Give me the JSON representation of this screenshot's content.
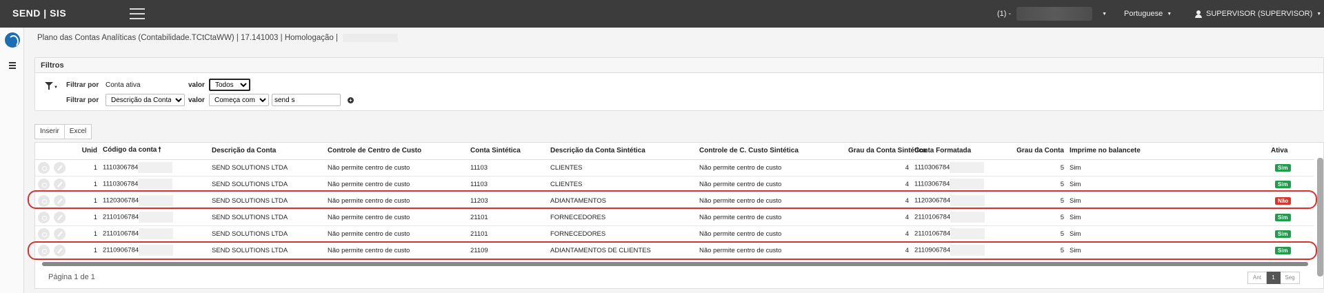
{
  "topbar": {
    "brand": "SEND | SIS",
    "company_prefix": "(1) -",
    "language": "Portuguese",
    "user": "SUPERVISOR (SUPERVISOR)"
  },
  "breadcrumb": "Plano das Contas Analíticas (Contabilidade.TCtCtaWW) | 17.141003 | Homologação |",
  "filters": {
    "title": "Filtros",
    "row1": {
      "label": "Filtrar por",
      "field": "Conta ativa",
      "value_label": "valor",
      "value_selected": "Todos"
    },
    "row2": {
      "label": "Filtrar por",
      "field_selected": "Descrição da Conta",
      "value_label": "valor",
      "operator_selected": "Começa com",
      "text_value": "send s"
    }
  },
  "toolbar": {
    "insert": "Inserir",
    "excel": "Excel"
  },
  "columns": [
    "Unid",
    "Código da conta",
    "Descrição da Conta",
    "Controle de Centro de Custo",
    "Conta Sintética",
    "Descrição da Conta Sintética",
    "Controle de C. Custo Sintética",
    "Grau da Conta Sintética",
    "Conta Formatada",
    "Grau da Conta",
    "Imprime no balancete",
    "Ativa"
  ],
  "sort_indicator": "🠕",
  "rows": [
    {
      "unid": "1",
      "codigo": "1110306784",
      "descricao": "SEND SOLUTIONS LTDA",
      "controle": "Não permite centro de custo",
      "sintetica": "11103",
      "desc_sintetica": "CLIENTES",
      "controle_sint": "Não permite centro de custo",
      "grau_sint": "4",
      "formatada": "1110306784",
      "grau": "5",
      "imprime": "Sim",
      "ativa": "Sim",
      "ativa_color": "#1e9e4a"
    },
    {
      "unid": "1",
      "codigo": "1110306784",
      "descricao": "SEND SOLUTIONS LTDA",
      "controle": "Não permite centro de custo",
      "sintetica": "11103",
      "desc_sintetica": "CLIENTES",
      "controle_sint": "Não permite centro de custo",
      "grau_sint": "4",
      "formatada": "1110306784",
      "grau": "5",
      "imprime": "Sim",
      "ativa": "Sim",
      "ativa_color": "#1e9e4a"
    },
    {
      "unid": "1",
      "codigo": "1120306784",
      "descricao": "SEND SOLUTIONS LTDA",
      "controle": "Não permite centro de custo",
      "sintetica": "11203",
      "desc_sintetica": "ADIANTAMENTOS",
      "controle_sint": "Não permite centro de custo",
      "grau_sint": "4",
      "formatada": "1120306784",
      "grau": "5",
      "imprime": "Sim",
      "ativa": "Não",
      "ativa_color": "#d9362c"
    },
    {
      "unid": "1",
      "codigo": "2110106784",
      "descricao": "SEND SOLUTIONS LTDA",
      "controle": "Não permite centro de custo",
      "sintetica": "21101",
      "desc_sintetica": "FORNECEDORES",
      "controle_sint": "Não permite centro de custo",
      "grau_sint": "4",
      "formatada": "2110106784",
      "grau": "5",
      "imprime": "Sim",
      "ativa": "Sim",
      "ativa_color": "#1e9e4a"
    },
    {
      "unid": "1",
      "codigo": "2110106784",
      "descricao": "SEND SOLUTIONS LTDA",
      "controle": "Não permite centro de custo",
      "sintetica": "21101",
      "desc_sintetica": "FORNECEDORES",
      "controle_sint": "Não permite centro de custo",
      "grau_sint": "4",
      "formatada": "2110106784",
      "grau": "5",
      "imprime": "Sim",
      "ativa": "Sim",
      "ativa_color": "#1e9e4a"
    },
    {
      "unid": "1",
      "codigo": "2110906784",
      "descricao": "SEND SOLUTIONS LTDA",
      "controle": "Não permite centro de custo",
      "sintetica": "21109",
      "desc_sintetica": "ADIANTAMENTOS DE CLIENTES",
      "controle_sint": "Não permite centro de custo",
      "grau_sint": "4",
      "formatada": "2110906784",
      "grau": "5",
      "imprime": "Sim",
      "ativa": "Sim",
      "ativa_color": "#1e9e4a"
    }
  ],
  "pager": {
    "text": "Página 1 de 1",
    "prev": "Ant",
    "current": "1",
    "next": "Seg"
  }
}
